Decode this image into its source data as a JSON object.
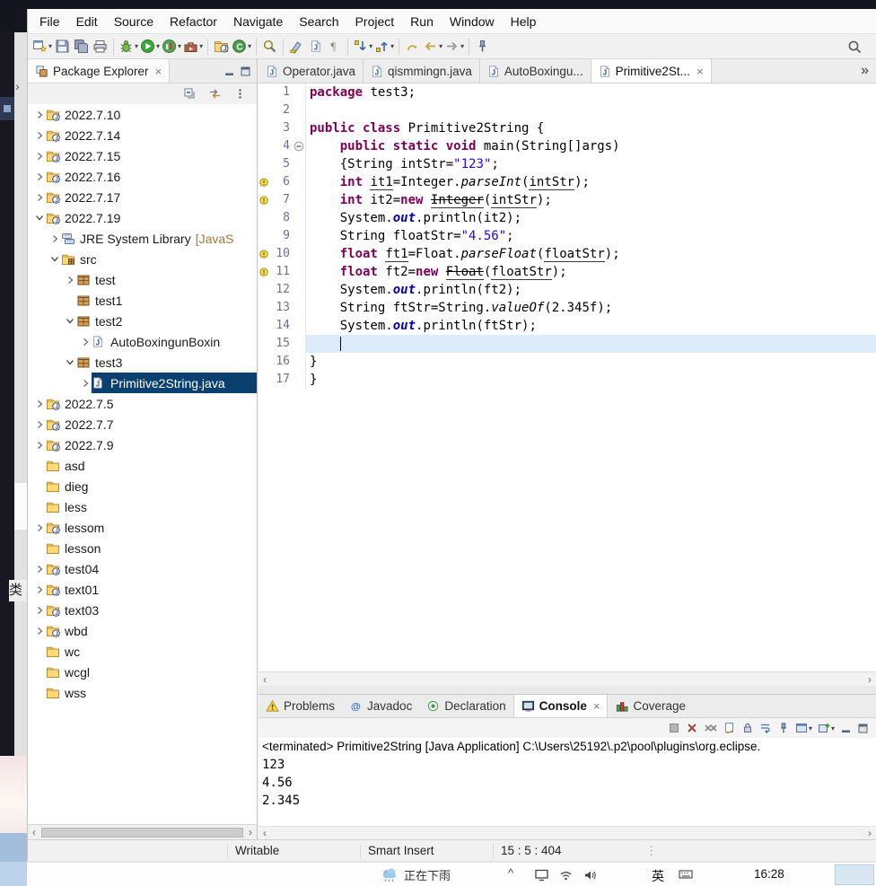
{
  "colors": {
    "selection": "#0a4070",
    "keyword": "#7f0055",
    "string": "#2a00ff",
    "field": "#0000c0",
    "current_line": "#dcecfb"
  },
  "glyphs": {
    "close": "×",
    "overflow": "»",
    "scroll_left": "‹",
    "scroll_right": "›",
    "dropdown": "▾",
    "handle": "⋮",
    "tray_chevron": "^"
  },
  "background": {
    "left_panel_text": "类"
  },
  "menu": {
    "items": [
      "File",
      "Edit",
      "Source",
      "Refactor",
      "Navigate",
      "Search",
      "Project",
      "Run",
      "Window",
      "Help"
    ]
  },
  "toolbar": {
    "groups": [
      {
        "icons": [
          {
            "name": "new-wizard",
            "dropdown": true
          },
          {
            "name": "save"
          },
          {
            "name": "save-all"
          },
          {
            "name": "print"
          }
        ]
      },
      {
        "icons": [
          {
            "name": "debug",
            "dropdown": true
          },
          {
            "name": "run",
            "dropdown": true
          },
          {
            "name": "coverage",
            "dropdown": true
          },
          {
            "name": "external-tools",
            "dropdown": true
          }
        ]
      },
      {
        "icons": [
          {
            "name": "new-java-project"
          },
          {
            "name": "new-class",
            "dropdown": true
          }
        ]
      },
      {
        "icons": [
          {
            "name": "search"
          }
        ]
      },
      {
        "icons": [
          {
            "name": "mark-occurrences"
          },
          {
            "name": "java-file"
          },
          {
            "name": "show-whitespace"
          }
        ]
      },
      {
        "icons": [
          {
            "name": "next-annotation",
            "dropdown": true
          },
          {
            "name": "prev-annotation",
            "dropdown": true
          }
        ]
      },
      {
        "icons": [
          {
            "name": "last-edit-location"
          },
          {
            "name": "back",
            "dropdown": true
          },
          {
            "name": "forward",
            "dropdown": true
          }
        ]
      },
      {
        "icons": [
          {
            "name": "pin-editor"
          }
        ]
      }
    ],
    "right_icon": "quick-search"
  },
  "package_explorer": {
    "title": "Package Explorer",
    "view_icon": "package-explorer",
    "toolbar_icons": [
      "collapse-all",
      "link-with-editor",
      "view-menu"
    ],
    "window_icons": [
      "minimize-view",
      "maximize-view"
    ],
    "tree": [
      {
        "label": "2022.7.10",
        "depth": 0,
        "icon": "java-project",
        "chevron": "collapsed"
      },
      {
        "label": "2022.7.14",
        "depth": 0,
        "icon": "java-project",
        "chevron": "collapsed"
      },
      {
        "label": "2022.7.15",
        "depth": 0,
        "icon": "java-project",
        "chevron": "collapsed"
      },
      {
        "label": "2022.7.16",
        "depth": 0,
        "icon": "java-project",
        "chevron": "collapsed"
      },
      {
        "label": "2022.7.17",
        "depth": 0,
        "icon": "java-project",
        "chevron": "collapsed"
      },
      {
        "label": "2022.7.19",
        "depth": 0,
        "icon": "java-project",
        "chevron": "expanded"
      },
      {
        "label": "JRE System Library",
        "decorator": "[JavaS",
        "depth": 1,
        "icon": "jre-library",
        "chevron": "collapsed"
      },
      {
        "label": "src",
        "depth": 1,
        "icon": "src-folder",
        "chevron": "expanded"
      },
      {
        "label": "test",
        "depth": 2,
        "icon": "package",
        "chevron": "collapsed"
      },
      {
        "label": "test1",
        "depth": 2,
        "icon": "package",
        "chevron": "none"
      },
      {
        "label": "test2",
        "depth": 2,
        "icon": "package",
        "chevron": "expanded"
      },
      {
        "label": "AutoBoxingunBoxin",
        "depth": 3,
        "icon": "java-file",
        "chevron": "collapsed"
      },
      {
        "label": "test3",
        "depth": 2,
        "icon": "package",
        "chevron": "expanded"
      },
      {
        "label": "Primitive2String.java",
        "depth": 3,
        "icon": "java-file",
        "chevron": "collapsed",
        "selected": true
      },
      {
        "label": "2022.7.5",
        "depth": 0,
        "icon": "java-project",
        "chevron": "collapsed"
      },
      {
        "label": "2022.7.7",
        "depth": 0,
        "icon": "java-project",
        "chevron": "collapsed"
      },
      {
        "label": "2022.7.9",
        "depth": 0,
        "icon": "java-project",
        "chevron": "collapsed"
      },
      {
        "label": "asd",
        "depth": 0,
        "icon": "folder",
        "chevron": "none"
      },
      {
        "label": "dieg",
        "depth": 0,
        "icon": "folder",
        "chevron": "none"
      },
      {
        "label": "less",
        "depth": 0,
        "icon": "folder",
        "chevron": "none"
      },
      {
        "label": "lessom",
        "depth": 0,
        "icon": "java-project",
        "chevron": "collapsed"
      },
      {
        "label": "lesson",
        "depth": 0,
        "icon": "folder",
        "chevron": "none"
      },
      {
        "label": "test04",
        "depth": 0,
        "icon": "java-project",
        "chevron": "collapsed"
      },
      {
        "label": "text01",
        "depth": 0,
        "icon": "java-project",
        "chevron": "collapsed"
      },
      {
        "label": "text03",
        "depth": 0,
        "icon": "java-project",
        "chevron": "collapsed"
      },
      {
        "label": "wbd",
        "depth": 0,
        "icon": "java-project",
        "chevron": "collapsed"
      },
      {
        "label": "wc",
        "depth": 0,
        "icon": "folder",
        "chevron": "none"
      },
      {
        "label": "wcgl",
        "depth": 0,
        "icon": "folder",
        "chevron": "none"
      },
      {
        "label": "wss",
        "depth": 0,
        "icon": "folder",
        "chevron": "none"
      }
    ]
  },
  "editor": {
    "tabs": [
      {
        "label": "Operator.java",
        "icon": "java-file",
        "active": false
      },
      {
        "label": "qismmingn.java",
        "icon": "java-file",
        "active": false
      },
      {
        "label": "AutoBoxingu...",
        "icon": "java-file",
        "active": false
      },
      {
        "label": "Primitive2St...",
        "icon": "java-file",
        "active": true,
        "close": true
      }
    ],
    "overflow_indicator": "»",
    "code_lines": [
      {
        "n": 1,
        "segs": [
          {
            "t": "package",
            "c": "k"
          },
          {
            "t": " test3;",
            "c": "p"
          }
        ]
      },
      {
        "n": 2,
        "segs": []
      },
      {
        "n": 3,
        "segs": [
          {
            "t": "public class",
            "c": "k"
          },
          {
            "t": " Primitive2String {",
            "c": "p"
          }
        ]
      },
      {
        "n": 4,
        "fold": true,
        "segs": [
          {
            "t": "    ",
            "c": "p"
          },
          {
            "t": "public static void",
            "c": "k"
          },
          {
            "t": " main(String[]args)",
            "c": "p"
          }
        ]
      },
      {
        "n": 5,
        "segs": [
          {
            "t": "    {String intStr=",
            "c": "p"
          },
          {
            "t": "\"123\"",
            "c": "s"
          },
          {
            "t": ";",
            "c": "p"
          }
        ]
      },
      {
        "n": 6,
        "marker": "warning",
        "segs": [
          {
            "t": "    ",
            "c": "p"
          },
          {
            "t": "int",
            "c": "k"
          },
          {
            "t": " ",
            "c": "p"
          },
          {
            "t": "it1",
            "c": "p u"
          },
          {
            "t": "=Integer.",
            "c": "p"
          },
          {
            "t": "parseInt",
            "c": "m"
          },
          {
            "t": "(",
            "c": "p"
          },
          {
            "t": "intStr",
            "c": "p u"
          },
          {
            "t": ");",
            "c": "p"
          }
        ]
      },
      {
        "n": 7,
        "marker": "warning",
        "segs": [
          {
            "t": "    ",
            "c": "p"
          },
          {
            "t": "int",
            "c": "k"
          },
          {
            "t": " it2=",
            "c": "p"
          },
          {
            "t": "new",
            "c": "k"
          },
          {
            "t": " ",
            "c": "p"
          },
          {
            "t": "Integer",
            "c": "p strike u"
          },
          {
            "t": "(",
            "c": "p"
          },
          {
            "t": "intStr",
            "c": "p u"
          },
          {
            "t": ");",
            "c": "p"
          }
        ]
      },
      {
        "n": 8,
        "segs": [
          {
            "t": "    System.",
            "c": "p"
          },
          {
            "t": "out",
            "c": "f"
          },
          {
            "t": ".println(it2);",
            "c": "p"
          }
        ]
      },
      {
        "n": 9,
        "segs": [
          {
            "t": "    String floatStr=",
            "c": "p"
          },
          {
            "t": "\"4.56\"",
            "c": "s"
          },
          {
            "t": ";",
            "c": "p"
          }
        ]
      },
      {
        "n": 10,
        "marker": "warning",
        "segs": [
          {
            "t": "    ",
            "c": "p"
          },
          {
            "t": "float",
            "c": "k"
          },
          {
            "t": " ",
            "c": "p"
          },
          {
            "t": "ft1",
            "c": "p u"
          },
          {
            "t": "=Float.",
            "c": "p"
          },
          {
            "t": "parseFloat",
            "c": "m"
          },
          {
            "t": "(",
            "c": "p"
          },
          {
            "t": "floatStr",
            "c": "p u"
          },
          {
            "t": ");",
            "c": "p"
          }
        ]
      },
      {
        "n": 11,
        "marker": "warning",
        "segs": [
          {
            "t": "    ",
            "c": "p"
          },
          {
            "t": "float",
            "c": "k"
          },
          {
            "t": " ft2=",
            "c": "p"
          },
          {
            "t": "new",
            "c": "k"
          },
          {
            "t": " ",
            "c": "p"
          },
          {
            "t": "Float",
            "c": "p strike u"
          },
          {
            "t": "(",
            "c": "p"
          },
          {
            "t": "floatStr",
            "c": "p u"
          },
          {
            "t": ");",
            "c": "p"
          }
        ]
      },
      {
        "n": 12,
        "segs": [
          {
            "t": "    System.",
            "c": "p"
          },
          {
            "t": "out",
            "c": "f"
          },
          {
            "t": ".println(ft2);",
            "c": "p"
          }
        ]
      },
      {
        "n": 13,
        "segs": [
          {
            "t": "    String ftStr=String.",
            "c": "p"
          },
          {
            "t": "valueOf",
            "c": "m"
          },
          {
            "t": "(2.345f);",
            "c": "p"
          }
        ]
      },
      {
        "n": 14,
        "segs": [
          {
            "t": "    System.",
            "c": "p"
          },
          {
            "t": "out",
            "c": "f"
          },
          {
            "t": ".println(ftStr);",
            "c": "p"
          }
        ]
      },
      {
        "n": 15,
        "current": true,
        "cursor": true,
        "cursor_col": 4,
        "segs": []
      },
      {
        "n": 16,
        "segs": [
          {
            "t": "}",
            "c": "p"
          }
        ]
      },
      {
        "n": 17,
        "segs": [
          {
            "t": "}",
            "c": "p"
          }
        ]
      }
    ]
  },
  "console": {
    "tabs": [
      {
        "label": "Problems",
        "icon": "problems",
        "active": false
      },
      {
        "label": "Javadoc",
        "icon": "javadoc",
        "active": false
      },
      {
        "label": "Declaration",
        "icon": "declaration",
        "active": false
      },
      {
        "label": "Console",
        "icon": "console-view",
        "active": true,
        "close": true
      },
      {
        "label": "Coverage",
        "icon": "coverage-view",
        "active": false
      }
    ],
    "toolbar_icons": [
      {
        "name": "terminate"
      },
      {
        "name": "remove-launch"
      },
      {
        "name": "remove-all-terminated"
      },
      {
        "name": "clear-console"
      },
      {
        "name": "scroll-lock"
      },
      {
        "name": "word-wrap"
      },
      {
        "name": "pin-console"
      },
      {
        "name": "display-selected-console",
        "dropdown": true
      },
      {
        "name": "open-console",
        "dropdown": true
      },
      {
        "name": "minimize-view"
      },
      {
        "name": "maximize-view"
      }
    ],
    "header": "<terminated> Primitive2String [Java Application] C:\\Users\\25192\\.p2\\pool\\plugins\\org.eclipse.",
    "output": [
      "123",
      "4.56",
      "2.345"
    ]
  },
  "status_bar": {
    "writable": "Writable",
    "insert_mode": "Smart Insert",
    "caret_position": "15 : 5 : 404"
  },
  "taskbar": {
    "weather_label": "正在下雨",
    "ime": "英",
    "time": "16:28"
  }
}
